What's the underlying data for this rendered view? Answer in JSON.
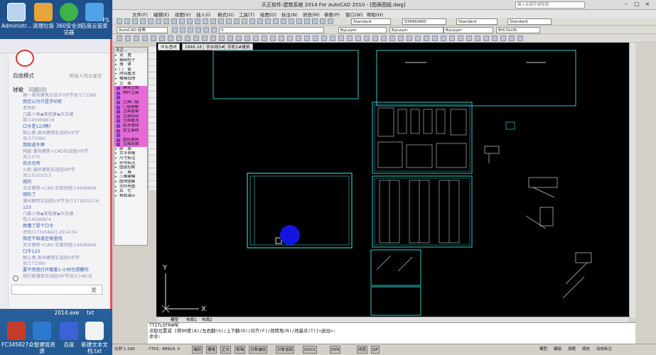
{
  "desktop": {
    "icons": [
      {
        "label": "Administr..."
      },
      {
        "label": "清理垃圾"
      },
      {
        "label": "360安全浏览器"
      },
      {
        "label": "百度云管家"
      },
      {
        "label": "FS"
      }
    ],
    "files": [
      {
        "label": "2014.exe"
      },
      {
        "label": "txt"
      }
    ],
    "bottom_icons": [
      {
        "label": "FC345827..."
      },
      {
        "label": "众智建筑资源"
      },
      {
        "label": "百度"
      },
      {
        "label": "新建文本文档.txt"
      }
    ]
  },
  "chat": {
    "mode_label": "自由模式",
    "mode_hint": "所有人可以发言",
    "tab_discuss": "讨论",
    "tab_question": "问题(0)",
    "messages": [
      {
        "kind": "sys",
        "text": "建一周州建筑云设计VIP学员/173390"
      },
      {
        "kind": "txt",
        "text": "我还以为只是学IE呢"
      },
      {
        "kind": "sys",
        "text": "老师好"
      },
      {
        "kind": "sys",
        "text": "几酷小咪◆奥能建◆天正建筑/14596987#"
      },
      {
        "kind": "txt",
        "text": "口令是123啊?"
      },
      {
        "kind": "sys",
        "text": "朗心意,周州建筑实战班VIP学员/173390"
      },
      {
        "kind": "txt",
        "text": "我知道令牌"
      },
      {
        "kind": "sys",
        "text": "同崖·潮州建筑+CAD实战班VIP学员/1270"
      },
      {
        "kind": "txt",
        "text": "后点也有"
      },
      {
        "kind": "sys",
        "text": "火箭·潮州建筑实战班VIP学员/15101013"
      },
      {
        "kind": "txt",
        "text": "我的"
      },
      {
        "kind": "sys",
        "text": "天正建筑+CAD 实案例班/14596846"
      },
      {
        "kind": "txt",
        "text": "明的了"
      },
      {
        "kind": "sys",
        "text": "潮州建筑实战班VIP学员/1371831576"
      },
      {
        "kind": "txt",
        "text": "123"
      },
      {
        "kind": "sys",
        "text": "几酷小咪◆奥能建◆天正建筑/14596874"
      },
      {
        "kind": "txt",
        "text": "我懂了是个口令"
      },
      {
        "kind": "sys",
        "text": "虎风(17345842)  2014:34"
      },
      {
        "kind": "txt",
        "text": "我还不知道在哪里找"
      },
      {
        "kind": "sys",
        "text": "天正建筑+CAD 实案例班/14596846"
      },
      {
        "kind": "txt",
        "text": "口令123"
      },
      {
        "kind": "sys",
        "text": "朗心意,周州建筑实战班VIP学员/173390"
      },
      {
        "kind": "txt",
        "text": "要不然我打开看看1-小时也提醒你"
      },
      {
        "kind": "sys",
        "text": "我们家建筑实战班VIP学员/174678"
      }
    ],
    "send_label": "发"
  },
  "cad": {
    "title": "天正软件-建筑系统 2014  For AutoCAD 2010 - [图表图纸.dwg]",
    "search_placeholder": "键入关键字或短语",
    "menus": [
      "文件(F)",
      "编辑(E)",
      "视图(V)",
      "插入(I)",
      "格式(O)",
      "工具(T)",
      "绘图(D)",
      "标注(N)",
      "修改(M)",
      "参数(P)",
      "窗口(W)",
      "帮助(H)"
    ],
    "toolbar1": {
      "style1": "Standard",
      "style2": "STANDARD",
      "style3": "Standard",
      "style4": "Standard"
    },
    "toolbar2": {
      "workspace": "AutoCAD 经典",
      "layer": "0",
      "color": "ByLayer",
      "linetype": "ByLayer",
      "lineweight": "ByLayer",
      "plotstyle": "BYCOLOR"
    },
    "palette": {
      "header": "天正...",
      "items": [
        {
          "label": "设　置",
          "sub": false
        },
        {
          "label": "轴网柱子",
          "sub": false
        },
        {
          "label": "墙　体",
          "sub": false
        },
        {
          "label": "门　窗",
          "sub": false
        },
        {
          "label": "房间屋顶",
          "sub": false
        },
        {
          "label": "楼梯其他",
          "sub": false
        },
        {
          "label": "立　面",
          "sub": false
        },
        {
          "label": "建筑立面",
          "sub": true
        },
        {
          "label": "构件立面",
          "sub": true
        },
        {
          "label": "",
          "sub": true
        },
        {
          "label": "立面门窗",
          "sub": true
        },
        {
          "label": "门窗参数",
          "sub": true
        },
        {
          "label": "立面窗套",
          "sub": true
        },
        {
          "label": "立面阳台",
          "sub": true
        },
        {
          "label": "立面屋顶",
          "sub": true
        },
        {
          "label": "雨水管线",
          "sub": true
        },
        {
          "label": "柱立面线",
          "sub": true
        },
        {
          "label": "",
          "sub": true
        },
        {
          "label": "图形裁剪",
          "sub": true
        },
        {
          "label": "立面轮廓",
          "sub": true
        },
        {
          "label": "剖　面",
          "sub": false
        },
        {
          "label": "文字表格",
          "sub": false
        },
        {
          "label": "尺寸标注",
          "sub": false
        },
        {
          "label": "符号标注",
          "sub": false
        },
        {
          "label": "图层控制",
          "sub": false
        },
        {
          "label": "工　具",
          "sub": false
        },
        {
          "label": "三维建模",
          "sub": false
        },
        {
          "label": "图块图案",
          "sub": false
        },
        {
          "label": "文件布图",
          "sub": false
        },
        {
          "label": "其　它",
          "sub": false
        },
        {
          "label": "帮助演示",
          "sub": false
        }
      ]
    },
    "canvas_tabs": [
      "所有图纸",
      "1846.18",
      "农业局5#",
      "农机1#建筑"
    ],
    "layout_tabs": [
      "模型",
      "布局1",
      "布局2"
    ],
    "axis_y": "Y",
    "axis_x": "X",
    "command_lines": [
      "TTITLEFRAME",
      "点取位置或 [转90度(A)/左右翻(S)/上下翻(D)/对齐(F)/改转角(R)/改基点(T)]<退出>:",
      "命令:"
    ],
    "status": {
      "scale": "比例 1:100",
      "coords": "-7753, -68914, 0",
      "buttons": [
        "捕捉",
        "栅格",
        "正交",
        "极轴",
        "对象捕捉",
        "对象追踪",
        "DUCS",
        "DYN",
        "线宽",
        "QP"
      ],
      "right": [
        "模型",
        "编组",
        "加粗",
        "填充",
        "动态标注"
      ]
    },
    "right_bar": "AutoCAD 经典"
  }
}
